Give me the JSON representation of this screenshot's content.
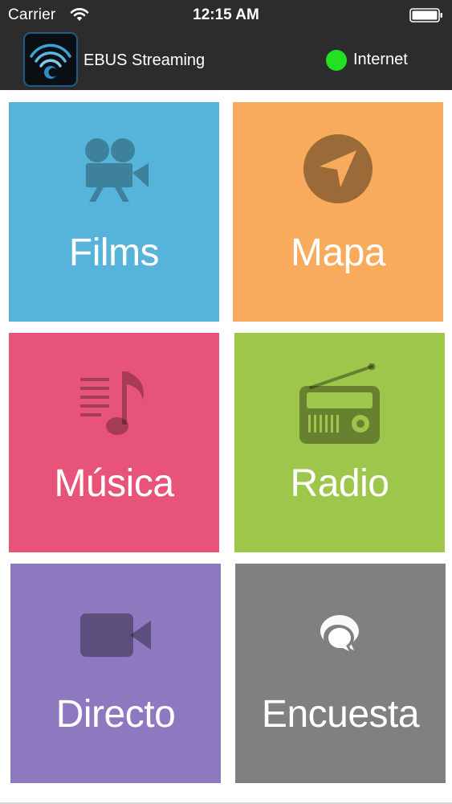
{
  "status_bar": {
    "carrier": "Carrier",
    "time": "12:15 AM"
  },
  "header": {
    "app_title": "EBUS Streaming",
    "connection_label": "Internet",
    "connection_color": "#22e022",
    "background_color": "#2c2c2c"
  },
  "tiles": [
    {
      "label": "Films",
      "icon": "movie-camera-icon",
      "color": "#56b3d9"
    },
    {
      "label": "Mapa",
      "icon": "navigation-icon",
      "color": "#f8ab5c"
    },
    {
      "label": "Música",
      "icon": "music-note-icon",
      "color": "#e75379"
    },
    {
      "label": "Radio",
      "icon": "radio-icon",
      "color": "#9ec64b"
    },
    {
      "label": "Directo",
      "icon": "video-camera-icon",
      "color": "#8e79c1"
    },
    {
      "label": "Encuesta",
      "icon": "chat-bubbles-icon",
      "color": "#808080"
    }
  ]
}
